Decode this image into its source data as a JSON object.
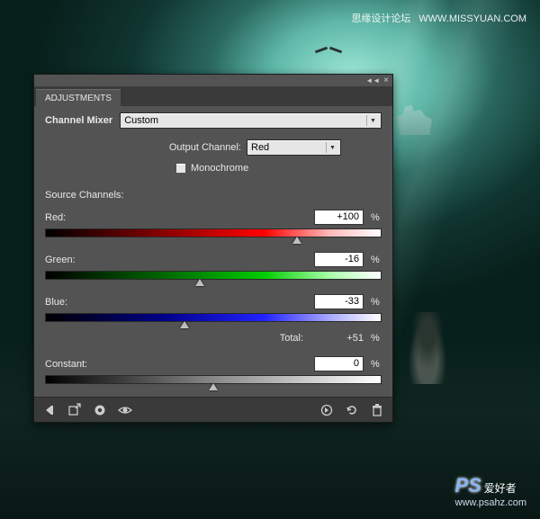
{
  "watermark": {
    "top_cn": "思缘设计论坛",
    "top_url": "WWW.MISSYUAN.COM",
    "bottom_logo": "PS",
    "bottom_cn": "爱好者",
    "bottom_url": "www.psahz.com"
  },
  "panel": {
    "tab": "ADJUSTMENTS",
    "title": "Channel Mixer",
    "preset": "Custom",
    "output_channel_label": "Output Channel:",
    "output_channel": "Red",
    "monochrome_label": "Monochrome",
    "section": "Source Channels:",
    "channels": {
      "red": {
        "label": "Red:",
        "value": "+100",
        "pos": 75
      },
      "green": {
        "label": "Green:",
        "value": "-16",
        "pos": 46
      },
      "blue": {
        "label": "Blue:",
        "value": "-33",
        "pos": 41.5
      }
    },
    "total_label": "Total:",
    "total_value": "+51",
    "percent": "%",
    "constant": {
      "label": "Constant:",
      "value": "0",
      "pos": 50
    }
  }
}
